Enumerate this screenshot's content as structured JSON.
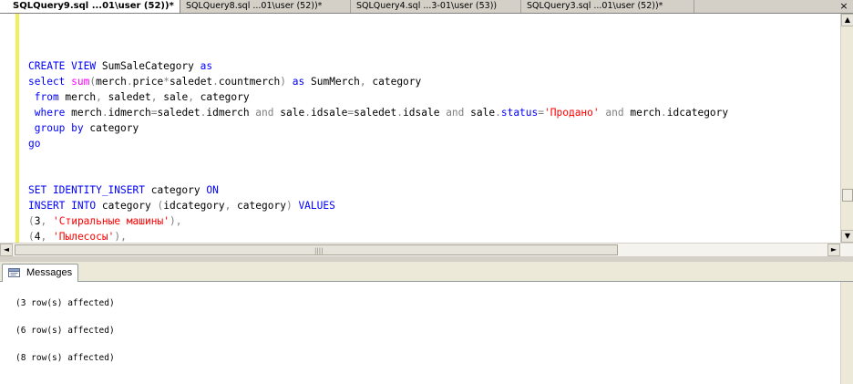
{
  "tabs": [
    {
      "label": "SQLQuery9.sql ...01\\user (52))*",
      "active": true
    },
    {
      "label": "SQLQuery8.sql ...01\\user (52))*",
      "active": false
    },
    {
      "label": "SQLQuery4.sql ...3-01\\user (53))",
      "active": false
    },
    {
      "label": "SQLQuery3.sql ...01\\user (52))*",
      "active": false
    }
  ],
  "tab_close_glyph": "×",
  "editor": {
    "lines": [
      [
        {
          "t": "CREATE VIEW",
          "c": "kw"
        },
        {
          "t": " SumSaleCategory ",
          "c": ""
        },
        {
          "t": "as",
          "c": "kw"
        }
      ],
      [
        {
          "t": "select",
          "c": "kw"
        },
        {
          "t": " ",
          "c": ""
        },
        {
          "t": "sum",
          "c": "fn"
        },
        {
          "t": "(",
          "c": "op"
        },
        {
          "t": "merch",
          "c": ""
        },
        {
          "t": ".",
          "c": "op"
        },
        {
          "t": "price",
          "c": ""
        },
        {
          "t": "*",
          "c": "op"
        },
        {
          "t": "saledet",
          "c": ""
        },
        {
          "t": ".",
          "c": "op"
        },
        {
          "t": "countmerch",
          "c": ""
        },
        {
          "t": ")",
          "c": "op"
        },
        {
          "t": " ",
          "c": ""
        },
        {
          "t": "as",
          "c": "kw"
        },
        {
          "t": " SumMerch",
          "c": ""
        },
        {
          "t": ",",
          "c": "op"
        },
        {
          "t": " category",
          "c": ""
        }
      ],
      [
        {
          "t": " from",
          "c": "kw"
        },
        {
          "t": " merch",
          "c": ""
        },
        {
          "t": ",",
          "c": "op"
        },
        {
          "t": " saledet",
          "c": ""
        },
        {
          "t": ",",
          "c": "op"
        },
        {
          "t": " sale",
          "c": ""
        },
        {
          "t": ",",
          "c": "op"
        },
        {
          "t": " category",
          "c": ""
        }
      ],
      [
        {
          "t": " where",
          "c": "kw"
        },
        {
          "t": " merch",
          "c": ""
        },
        {
          "t": ".",
          "c": "op"
        },
        {
          "t": "idmerch",
          "c": ""
        },
        {
          "t": "=",
          "c": "op"
        },
        {
          "t": "saledet",
          "c": ""
        },
        {
          "t": ".",
          "c": "op"
        },
        {
          "t": "idmerch ",
          "c": ""
        },
        {
          "t": "and",
          "c": "op"
        },
        {
          "t": " sale",
          "c": ""
        },
        {
          "t": ".",
          "c": "op"
        },
        {
          "t": "idsale",
          "c": ""
        },
        {
          "t": "=",
          "c": "op"
        },
        {
          "t": "saledet",
          "c": ""
        },
        {
          "t": ".",
          "c": "op"
        },
        {
          "t": "idsale ",
          "c": ""
        },
        {
          "t": "and",
          "c": "op"
        },
        {
          "t": " sale",
          "c": ""
        },
        {
          "t": ".",
          "c": "op"
        },
        {
          "t": "status",
          "c": "kw"
        },
        {
          "t": "=",
          "c": "op"
        },
        {
          "t": "'Продано'",
          "c": "str"
        },
        {
          "t": " ",
          "c": ""
        },
        {
          "t": "and",
          "c": "op"
        },
        {
          "t": " merch",
          "c": ""
        },
        {
          "t": ".",
          "c": "op"
        },
        {
          "t": "idcategory",
          "c": ""
        }
      ],
      [
        {
          "t": " group by",
          "c": "kw"
        },
        {
          "t": " category",
          "c": ""
        }
      ],
      [
        {
          "t": "go",
          "c": "kw"
        }
      ],
      [],
      [],
      [
        {
          "t": "SET IDENTITY_INSERT",
          "c": "kw"
        },
        {
          "t": " category ",
          "c": ""
        },
        {
          "t": "ON",
          "c": "kw"
        }
      ],
      [
        {
          "t": "INSERT INTO",
          "c": "kw"
        },
        {
          "t": " category ",
          "c": ""
        },
        {
          "t": "(",
          "c": "op"
        },
        {
          "t": "idcategory",
          "c": ""
        },
        {
          "t": ",",
          "c": "op"
        },
        {
          "t": " category",
          "c": ""
        },
        {
          "t": ")",
          "c": "op"
        },
        {
          "t": " ",
          "c": ""
        },
        {
          "t": "VALUES",
          "c": "kw"
        }
      ],
      [
        {
          "t": "(",
          "c": "op"
        },
        {
          "t": "3",
          "c": ""
        },
        {
          "t": ",",
          "c": "op"
        },
        {
          "t": " ",
          "c": ""
        },
        {
          "t": "'Стиральные машины'",
          "c": "str"
        },
        {
          "t": "),",
          "c": "op"
        }
      ],
      [
        {
          "t": "(",
          "c": "op"
        },
        {
          "t": "4",
          "c": ""
        },
        {
          "t": ",",
          "c": "op"
        },
        {
          "t": " ",
          "c": ""
        },
        {
          "t": "'Пылесосы'",
          "c": "str"
        },
        {
          "t": "),",
          "c": "op"
        }
      ]
    ]
  },
  "colors": {
    "keyword": "#0000ff",
    "function": "#ff00ff",
    "operator": "#808080",
    "string": "#ff0000",
    "change_bar": "#f2ee5c"
  },
  "results": {
    "tab_label": "Messages",
    "tab_icon": "messages-icon",
    "messages": [
      "(3 row(s) affected)",
      "(6 row(s) affected)",
      "(8 row(s) affected)"
    ]
  },
  "scroll": {
    "up_glyph": "▲",
    "down_glyph": "▼",
    "left_glyph": "◄",
    "right_glyph": "►"
  }
}
